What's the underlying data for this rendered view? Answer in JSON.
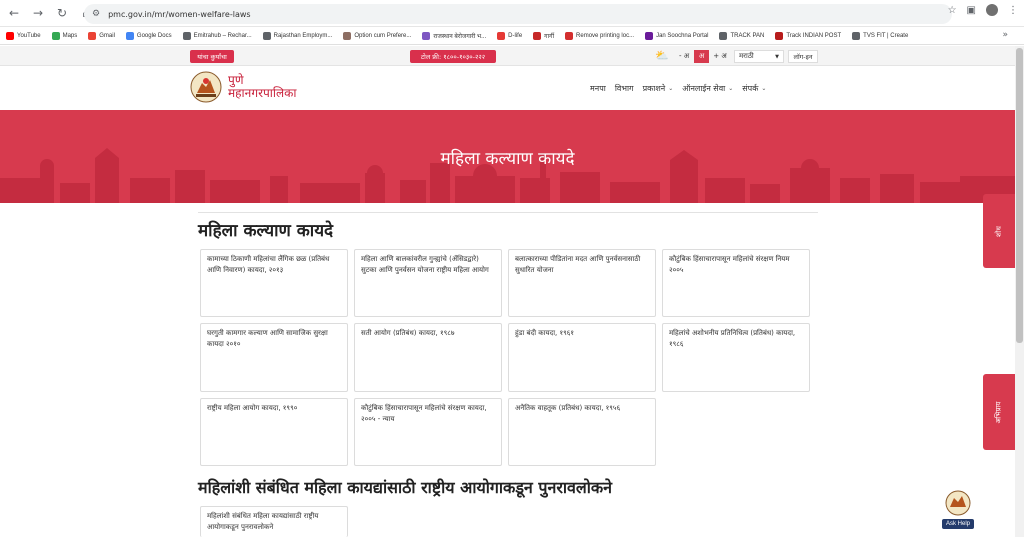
{
  "browser": {
    "url": "pmc.gov.in/mr/women-welfare-laws",
    "bookmarks": [
      {
        "label": "YouTube",
        "color": "#ff0000"
      },
      {
        "label": "Maps",
        "color": "#34a853"
      },
      {
        "label": "Gmail",
        "color": "#ea4335"
      },
      {
        "label": "Google Docs",
        "color": "#4285f4"
      },
      {
        "label": "Emitrahub – Rechar...",
        "color": "#5f6368"
      },
      {
        "label": "Rajasthan Employm...",
        "color": "#5f6368"
      },
      {
        "label": "Option cum Prefere...",
        "color": "#8d6e63"
      },
      {
        "label": "राजस्थान बेरोजगारी भ...",
        "color": "#7e57c2"
      },
      {
        "label": "D-life",
        "color": "#e53935"
      },
      {
        "label": "गार्गी",
        "color": "#c62828"
      },
      {
        "label": "Remove printing loc...",
        "color": "#d32f2f"
      },
      {
        "label": "Jan Soochna Portal",
        "color": "#6a1b9a"
      },
      {
        "label": "TRACK PAN",
        "color": "#5f6368"
      },
      {
        "label": "Track INDIAN POST",
        "color": "#b71c1c"
      },
      {
        "label": "TVS FIT | Create",
        "color": "#5f6368"
      }
    ]
  },
  "topbar": {
    "left_badge": "यांचा कुर्यांचा",
    "toll_free": "टोल फ्री: १८००-१०३०-२२२",
    "font_minus": "- अ",
    "font_normal": "अ",
    "font_plus": "+ अ",
    "language": "मराठी",
    "login": "लॉग-इन"
  },
  "header": {
    "brand_line1": "पुणे",
    "brand_line2": "महानगरपालिका",
    "nav": [
      "मनपा",
      "विभाग",
      "प्रकाशने",
      "ऑनलाईन सेवा",
      "संपर्क"
    ]
  },
  "banner": {
    "title": "महिला कल्याण कायदे"
  },
  "section1": {
    "heading": "महिला कल्याण कायदे",
    "cards": [
      "कामाच्या ठिकाणी महिलांचा लैंगिक छळ (प्रतिबंध आणि निवारण) कायदा, २०१३",
      "महिला आणि बालकांवरील गुन्ह्यांचे (ॲसिडद्वारे) सुटका आणि पुनर्वसन योजना राष्ट्रीय महिला आयोग",
      "बलात्काराच्या पीडितांना मदत आणि पुनर्वसनासाठी सुधारित योजना",
      "कौटुंबिक हिंसाचारापासून महिलांचे संरक्षण नियम २००५",
      "घरगुती कामगार कल्याण आणि सामाजिक सुरक्षा कायदा २०१०",
      "सती आयोग (प्रतिबंध) कायदा, १९८७",
      "हुंडा बंदी कायदा, १९६१",
      "महिलांचे अशोभनीय प्रतिनिधित्व (प्रतिबंध) कायदा, १९८६",
      "राष्ट्रीय महिला आयोग कायदा, १९९०",
      "कौटुंबिक हिंसाचारापासून महिलांचे संरक्षण कायदा, २००५ - न्याय",
      "अनैतिक वाहतूक (प्रतिबंध) कायदा, १९५६"
    ]
  },
  "section2": {
    "heading": "महिलांशी संबंधित महिला कायद्यांसाठी राष्ट्रीय आयोगाकडून पुनरावलोकने",
    "cards": [
      "महिलांशी संबंधित महिला कायद्यांसाठी राष्ट्रीय आयोगाकडून पुनरावलोकने"
    ]
  },
  "side_tabs": {
    "tab1": "शोध",
    "tab2": "अभिप्राय"
  },
  "ask_help": "Ask Help",
  "colors": {
    "accent": "#d73a4e",
    "brand_text": "#c8203a"
  }
}
